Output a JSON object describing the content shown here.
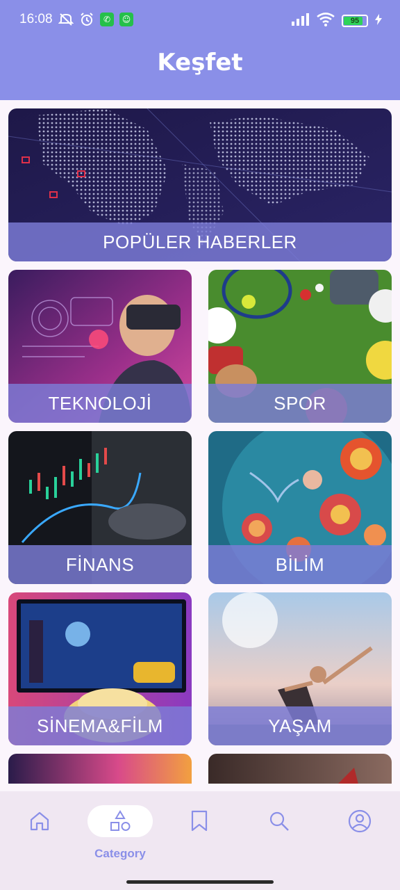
{
  "status_bar": {
    "time": "16:08",
    "battery": "95"
  },
  "header": {
    "title": "Keşfet"
  },
  "categories": [
    {
      "label": "POPÜLER HABERLER"
    },
    {
      "label": "TEKNOLOJİ"
    },
    {
      "label": "SPOR"
    },
    {
      "label": "FİNANS"
    },
    {
      "label": "BİLİM"
    },
    {
      "label": "SİNEMA&FİLM"
    },
    {
      "label": "YAŞAM"
    }
  ],
  "nav": {
    "active_label": "Category"
  },
  "colors": {
    "accent": "#8a8fe8",
    "caption": "#7d7dd7",
    "nav_bg": "#f0e7f2"
  }
}
